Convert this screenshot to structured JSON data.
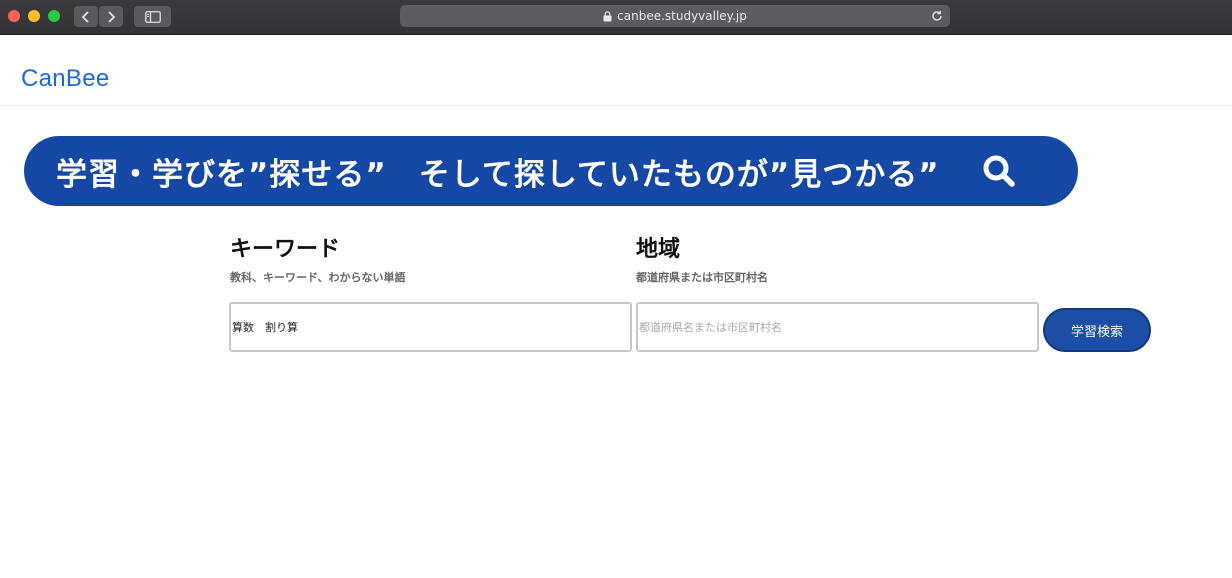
{
  "browser": {
    "url": "canbee.studyvalley.jp"
  },
  "site": {
    "logo": "CanBee"
  },
  "banner": {
    "text": "学習・学びを”探せる”　そして探していたものが”見つかる”"
  },
  "form": {
    "keyword": {
      "title": "キーワード",
      "subtitle": "教科、キーワード、わからない単語",
      "value": "算数　割り算"
    },
    "region": {
      "title": "地域",
      "subtitle": "都道府県または市区町村名",
      "placeholder": "都道府県名または市区町村名"
    },
    "submit_label": "学習検索"
  },
  "colors": {
    "brand_blue": "#1547a4",
    "logo_blue": "#1a6ad6"
  }
}
